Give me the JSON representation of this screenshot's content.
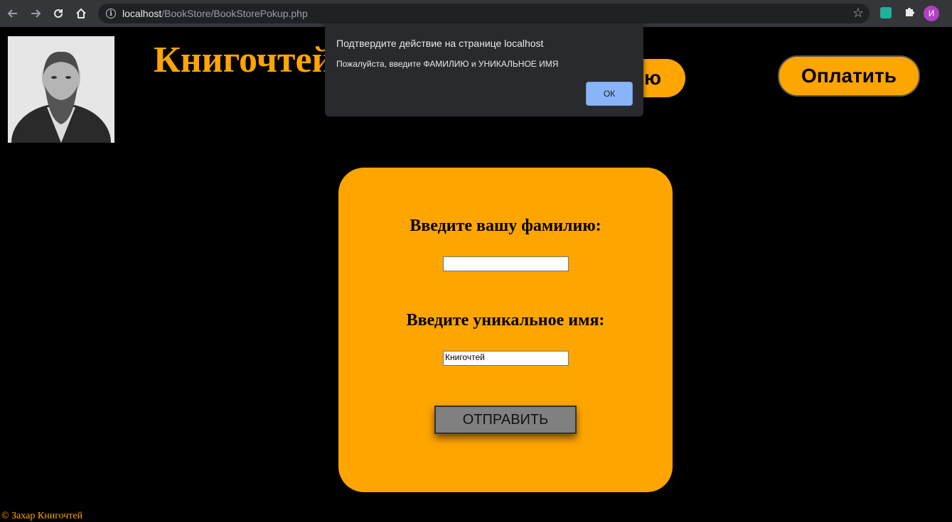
{
  "browser": {
    "url_host": "localhost",
    "url_path": "/BookStore/BookStorePokup.php",
    "profile_initial": "И"
  },
  "header": {
    "site_title": "Книгочтей",
    "left_button_label": "ю",
    "pay_button_label": "Оплатить"
  },
  "dialog": {
    "title": "Подтвердите действие на странице localhost",
    "message": "Пожалуйста, введите ФАМИЛИЮ и УНИКАЛЬНОЕ ИМЯ",
    "ok_label": "ОК"
  },
  "form": {
    "surname_label": "Введите вашу фамилию:",
    "surname_value": "",
    "name_label": "Введите уникальное имя:",
    "name_value": "Книгочтей",
    "submit_label": "ОТПРАВИТЬ"
  },
  "footer": {
    "copyright": "© Захар Книгочтей"
  },
  "colors": {
    "accent": "#ffa500",
    "page_background": "#000000",
    "dialog_background": "#292a2d",
    "dialog_ok": "#8ab4f8"
  }
}
